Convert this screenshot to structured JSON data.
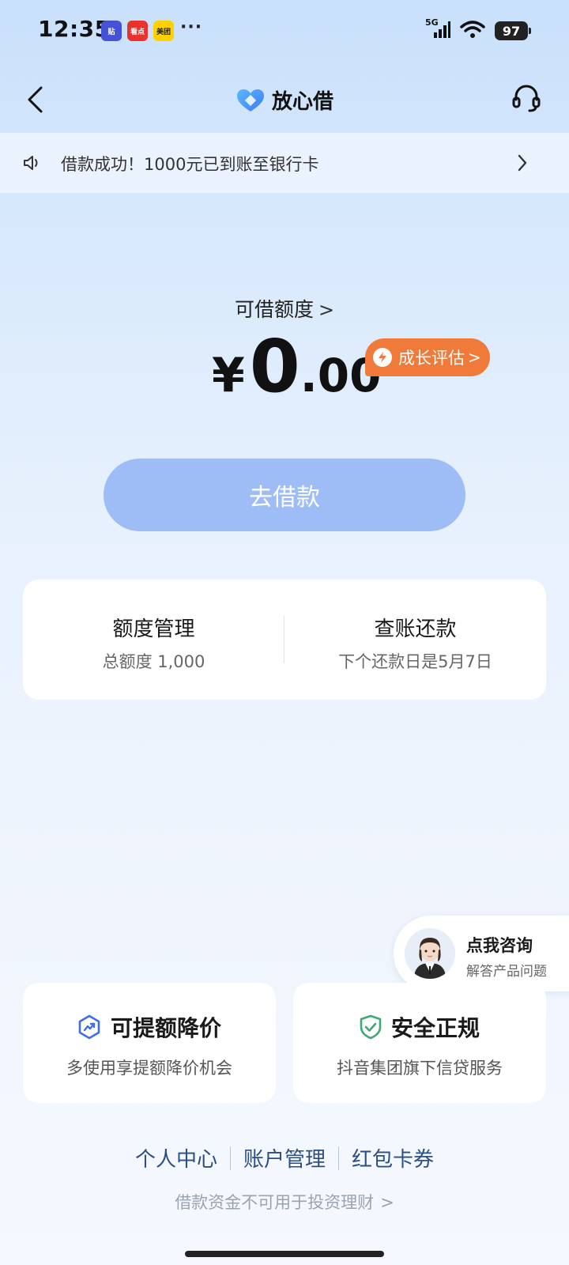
{
  "status_bar": {
    "time": "12:35",
    "notifications": [
      "贴",
      "看点",
      "美团"
    ],
    "more": "···",
    "network": "5G",
    "battery": "97"
  },
  "header": {
    "title": "放心借",
    "back_icon": "chevron-left-icon",
    "support_icon": "headset-icon"
  },
  "notice": {
    "text": "借款成功！1000元已到账至银行卡"
  },
  "credit": {
    "label": "可借额度",
    "currency": "¥",
    "amount_int": "0",
    "amount_dec": ".00",
    "growth_badge": "成长评估"
  },
  "borrow_button": "去借款",
  "management": {
    "limit_title": "额度管理",
    "limit_sub": "总额度 1,000",
    "repay_title": "查账还款",
    "repay_sub": "下个还款日是5月7日"
  },
  "consult": {
    "title": "点我咨询",
    "subtitle": "解答产品问题"
  },
  "features": [
    {
      "title": "可提额降价",
      "subtitle": "多使用享提额降价机会",
      "icon": "trend-up-icon"
    },
    {
      "title": "安全正规",
      "subtitle": "抖音集团旗下信贷服务",
      "icon": "shield-check-icon"
    }
  ],
  "footer": {
    "links": [
      "个人中心",
      "账户管理",
      "红包卡券"
    ],
    "disclaimer": "借款资金不可用于投资理财"
  },
  "colors": {
    "accent": "#9ebcf6",
    "badge": "#f07a3a",
    "link": "#2b4e84"
  }
}
